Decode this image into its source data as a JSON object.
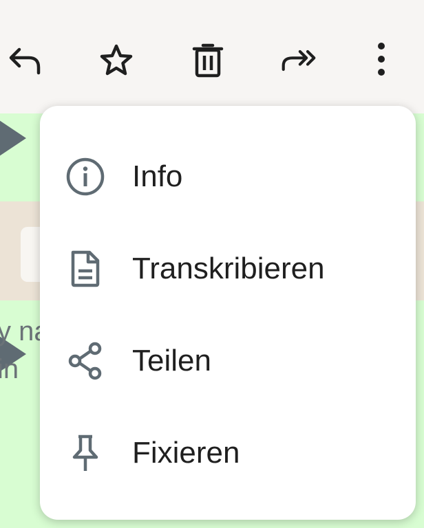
{
  "toolbar": {
    "icons": [
      "reply-icon",
      "star-icon",
      "delete-icon",
      "forward-icon",
      "more-options-icon"
    ]
  },
  "chat": {
    "snippet_lines": [
      "y na",
      " in"
    ]
  },
  "menu": {
    "items": [
      {
        "label": "Info",
        "icon": "info-icon"
      },
      {
        "label": "Transkribieren",
        "icon": "document-icon"
      },
      {
        "label": "Teilen",
        "icon": "share-icon"
      },
      {
        "label": "Fixieren",
        "icon": "pin-icon"
      }
    ]
  },
  "colors": {
    "toolbar_bg": "#f7f5f3",
    "outgoing_bubble": "#d8fdd2",
    "icon_gray": "#5f6b73",
    "menu_bg": "#ffffff",
    "text": "#1f1f1f"
  }
}
